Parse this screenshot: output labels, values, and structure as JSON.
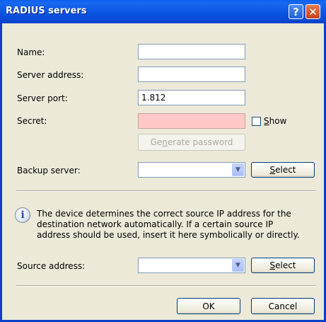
{
  "window": {
    "title": "RADIUS servers",
    "help_glyph": "?",
    "close_glyph": "✕"
  },
  "form": {
    "name_label": "Name:",
    "name_value": "",
    "server_address_label": "Server address:",
    "server_address_value": "",
    "server_port_label": "Server port:",
    "server_port_value": "1.812",
    "secret_label": "Secret:",
    "secret_value": "",
    "show_label_underlined": "S",
    "show_label_rest": "how",
    "show_checked": false,
    "generate_password_pre": "Ge",
    "generate_password_underlined": "n",
    "generate_password_post": "erate password",
    "backup_server_label": "Backup server:",
    "backup_server_value": "",
    "select_underlined": "S",
    "select_rest": "elect"
  },
  "info": {
    "icon": "info-icon",
    "lines": [
      "The device determines the correct source IP address for the",
      "destination network automatically. If a certain source IP",
      "address should be used, insert it here symbolically or directly."
    ]
  },
  "source": {
    "source_address_label": "Source address:",
    "source_address_value": "",
    "select_underlined": "S",
    "select_rest": "elect"
  },
  "footer": {
    "ok_label": "OK",
    "cancel_label": "Cancel"
  },
  "colors": {
    "title_bar": "#0a55e3",
    "dialog_bg": "#ece9d8",
    "secret_field_bg": "#ffc9c9"
  }
}
